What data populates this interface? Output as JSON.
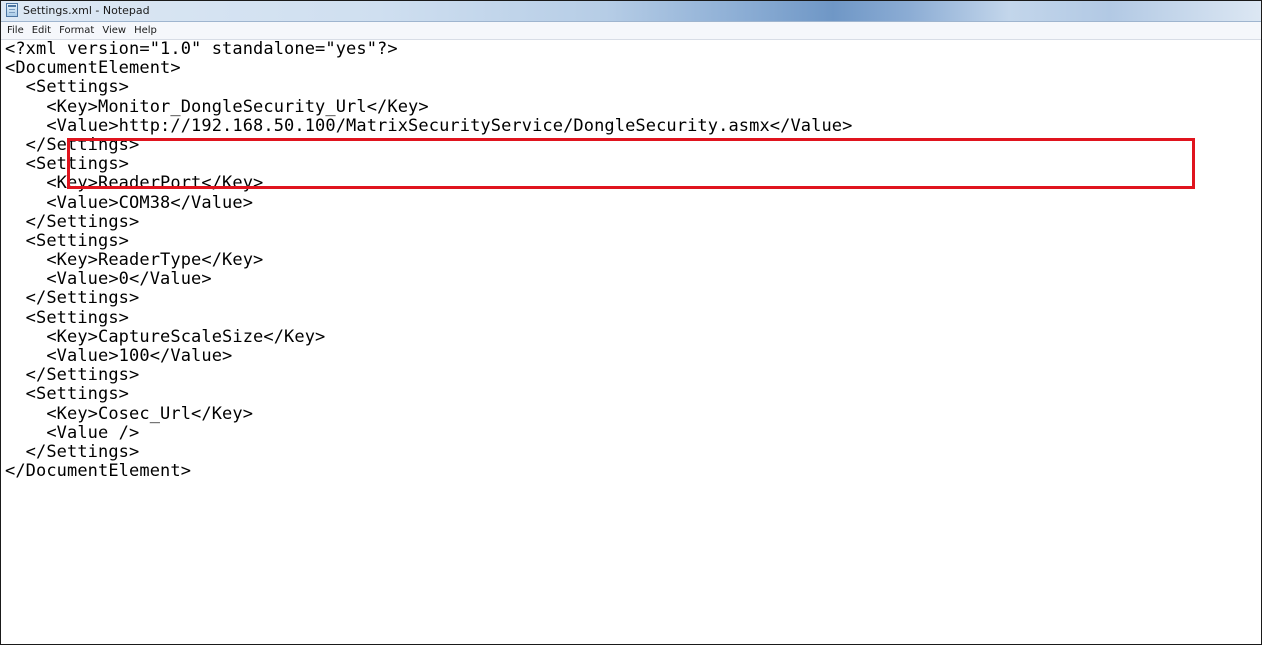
{
  "window": {
    "title": "Settings.xml - Notepad",
    "icon": "notepad-icon"
  },
  "menu": [
    "File",
    "Edit",
    "Format",
    "View",
    "Help"
  ],
  "document": {
    "lines": [
      "<?xml version=\"1.0\" standalone=\"yes\"?>",
      "<DocumentElement>",
      "  <Settings>",
      "    <Key>Monitor_DongleSecurity_Url</Key>",
      "    <Value>http://192.168.50.100/MatrixSecurityService/DongleSecurity.asmx</Value>",
      "  </Settings>",
      "  <Settings>",
      "    <Key>ReaderPort</Key>",
      "    <Value>COM38</Value>",
      "  </Settings>",
      "  <Settings>",
      "    <Key>ReaderType</Key>",
      "    <Value>0</Value>",
      "  </Settings>",
      "  <Settings>",
      "    <Key>CaptureScaleSize</Key>",
      "    <Value>100</Value>",
      "  </Settings>",
      "  <Settings>",
      "    <Key>Cosec_Url</Key>",
      "    <Value />",
      "  </Settings>",
      "</DocumentElement>"
    ]
  },
  "annotation": {
    "color": "#e0141e"
  }
}
